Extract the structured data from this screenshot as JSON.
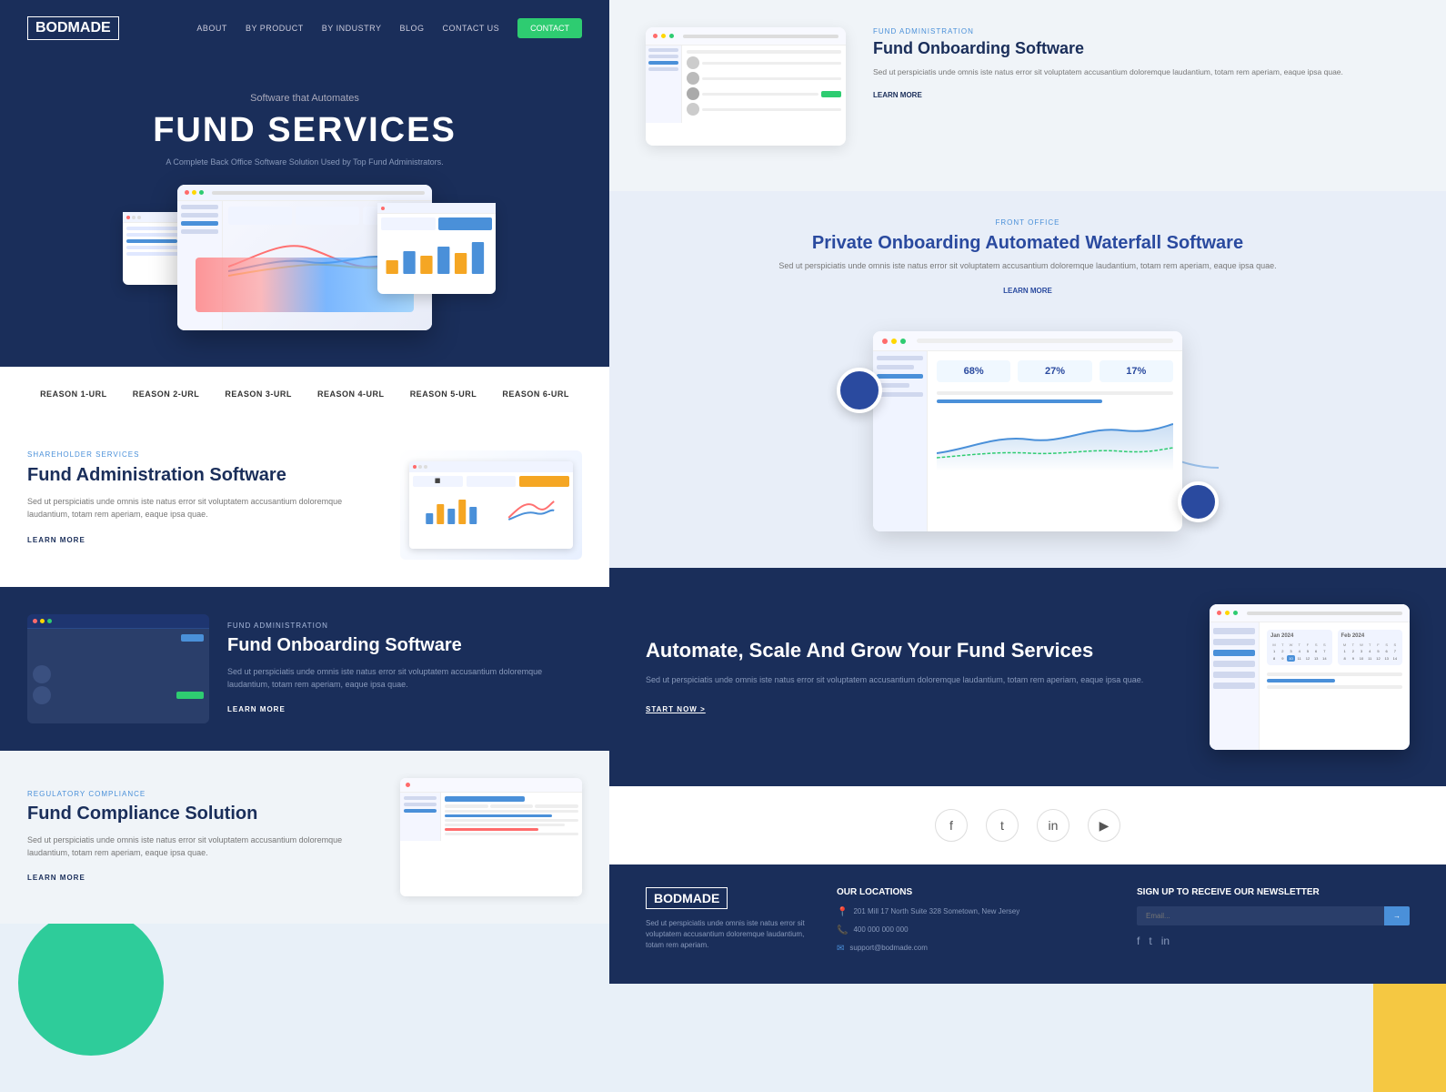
{
  "brand": {
    "logo": "BODMADE",
    "tagline": "Software that Automates",
    "hero_title": "FUND SERVICES",
    "hero_desc": "A Complete Back Office Software Solution Used by Top Fund Administrators."
  },
  "nav": {
    "links": [
      "ABOUT",
      "BY PRODUCT",
      "BY INDUSTRY",
      "BLOG",
      "CONTACT US"
    ],
    "cta": "CONTACT"
  },
  "reasons": {
    "items": [
      "REASON 1-URL",
      "REASON 2-URL",
      "REASON 3-URL",
      "REASON 4-URL",
      "REASON 5-URL",
      "REASON 6-URL"
    ]
  },
  "features": {
    "fund_admin": {
      "tag": "SHAREHOLDER SERVICES",
      "title": "Fund Administration Software",
      "desc": "Sed ut perspiciatis unde omnis iste natus error sit voluptatem accusantium doloremque laudantium, totam rem aperiam, eaque ipsa quae.",
      "learn_more": "LEARN MORE"
    },
    "fund_onboarding": {
      "tag": "FUND ADMINISTRATION",
      "title": "Fund Onboarding Software",
      "desc": "Sed ut perspiciatis unde omnis iste natus error sit voluptatem accusantium doloremque laudantium, totam rem aperiam, eaque ipsa quae.",
      "learn_more": "LEARN MORE"
    },
    "fund_onboarding_right": {
      "tag": "FUND ADMINISTRATION",
      "title": "Fund Onboarding Software",
      "desc": "Sed ut perspiciatis unde omnis iste natus error sit voluptatem accusantium doloremque laudantium, totam rem aperiam, eaque ipsa quae.",
      "learn_more": "LEARN MORE"
    },
    "waterfall": {
      "tag": "FRONT OFFICE",
      "title": "Private Onboarding Automated Waterfall Software",
      "desc": "Sed ut perspiciatis unde omnis iste natus error sit voluptatem accusantium doloremque laudantium, totam rem aperiam, eaque ipsa quae.",
      "learn_more": "LEARN MORE"
    },
    "compliance": {
      "tag": "REGULATORY COMPLIANCE",
      "title": "Fund Compliance Solution",
      "desc": "Sed ut perspiciatis unde omnis iste natus error sit voluptatem accusantium doloremque laudantium, totam rem aperiam, eaque ipsa quae.",
      "learn_more": "LEARN MORE"
    }
  },
  "automate": {
    "title": "Automate, Scale And Grow Your Fund Services",
    "desc": "Sed ut perspiciatis unde omnis iste natus error sit voluptatem accusantium doloremque laudantium, totam rem aperiam, eaque ipsa quae.",
    "cta": "START NOW >"
  },
  "social": {
    "icons": [
      "f",
      "t",
      "in",
      "▶"
    ]
  },
  "footer": {
    "logo": "BODMADE",
    "tagline": "Sed ut perspiciatis unde omnis iste natus error sit voluptatem accusantium doloremque laudantium, totam rem aperiam.",
    "locations_title": "Our Locations",
    "locations": [
      {
        "icon": "📍",
        "text": "201 Mill 17 North Suite 328\nSometown, New Jersey"
      },
      {
        "icon": "📞",
        "text": "400 000 000 000"
      },
      {
        "icon": "✉",
        "text": "support@bodmade.com"
      }
    ],
    "newsletter_title": "SIGN UP TO RECEIVE OUR NEWSLETTER",
    "newsletter_placeholder": "Email...",
    "newsletter_btn": "→",
    "social_icons": [
      "f",
      "t",
      "in"
    ]
  },
  "waterfall_stats": {
    "val1": "68%",
    "val2": "27%",
    "val3": "17%"
  }
}
